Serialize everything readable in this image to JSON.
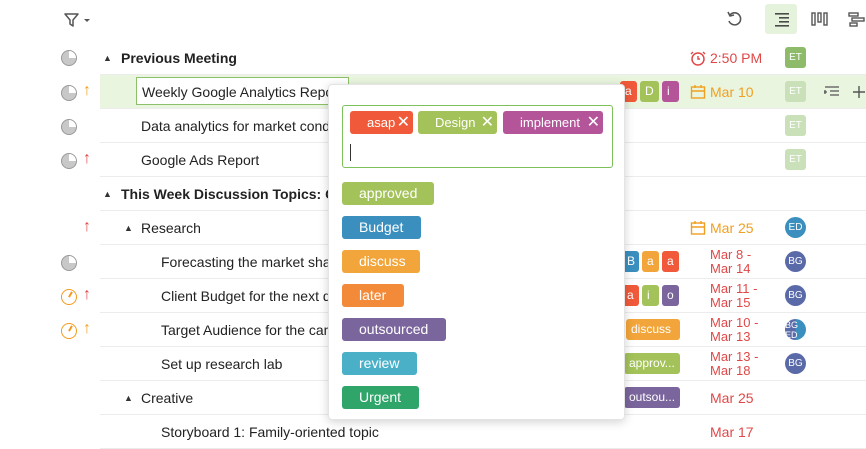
{
  "toolbar": {
    "filter_icon": "filter-icon",
    "undo_icon": "undo-icon",
    "list_view_icon": "list-view-icon",
    "board_view_icon": "board-view-icon",
    "gantt_view_icon": "gantt-view-icon"
  },
  "rows": {
    "previous_meeting": {
      "title": "Previous Meeting",
      "time": "2:50 PM",
      "avatar": "ET"
    },
    "weekly_ga": {
      "title": "Weekly Google Analytics Report",
      "chip_a": "a",
      "chip_d": "D",
      "chip_i": "i",
      "date": "Mar 10",
      "avatar": "ET"
    },
    "data_analytics": {
      "title": "Data analytics for market conditions",
      "avatar": "ET"
    },
    "google_ads": {
      "title": "Google Ads Report",
      "avatar": "ET"
    },
    "this_week": {
      "title": "This Week Discussion Topics: Campaign"
    },
    "research": {
      "title": "Research",
      "date": "Mar 25",
      "avatar": "ED"
    },
    "forecasting": {
      "title": "Forecasting the market share",
      "chip_b": "B",
      "chip_a": "a",
      "chip_a2": "a",
      "date1": "Mar 8 -",
      "date2": "Mar 14",
      "avatar": "BG"
    },
    "client_budget": {
      "title": "Client Budget for the next quarter",
      "chip_a": "a",
      "chip_i": "i",
      "chip_o": "o",
      "date1": "Mar 11 -",
      "date2": "Mar 15",
      "avatar": "BG"
    },
    "target_audience": {
      "title": "Target Audience for the campaign",
      "chip": "discuss",
      "date1": "Mar 10 -",
      "date2": "Mar 13",
      "avatar": "BG ED"
    },
    "research_lab": {
      "title": "Set up research lab",
      "chip": "approv...",
      "date1": "Mar 13 -",
      "date2": "Mar 18",
      "avatar": "BG"
    },
    "creative": {
      "title": "Creative",
      "chip": "outsou...",
      "date": "Mar 25"
    },
    "storyboard": {
      "title": "Storyboard 1: Family-oriented topic",
      "date": "Mar 17"
    }
  },
  "popup": {
    "selected_tags": [
      {
        "label": "asap",
        "color": "#f05a3a"
      },
      {
        "label": "Design",
        "color": "#a4c25a"
      },
      {
        "label": "implement",
        "color": "#b4559a"
      }
    ],
    "remove_icon": "close-icon",
    "options": [
      {
        "label": "approved",
        "color": "#a4c25a"
      },
      {
        "label": "Budget",
        "color": "#3b8fbf"
      },
      {
        "label": "discuss",
        "color": "#f2a53a"
      },
      {
        "label": "later",
        "color": "#f28a3a"
      },
      {
        "label": "outsourced",
        "color": "#7a659c"
      },
      {
        "label": "review",
        "color": "#4ab0c8"
      },
      {
        "label": "Urgent",
        "color": "#2fa56a"
      }
    ]
  }
}
